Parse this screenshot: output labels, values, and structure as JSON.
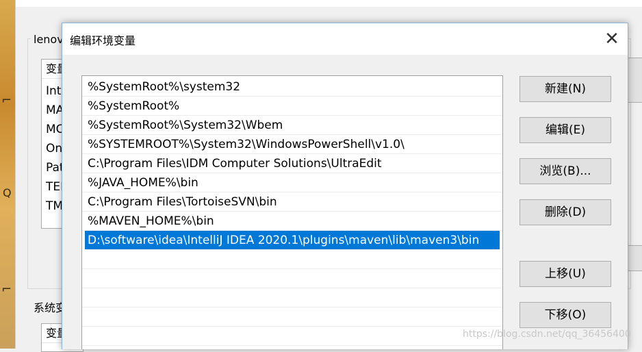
{
  "dialog": {
    "title": "编辑环境变量",
    "close_glyph": "✕",
    "paths": [
      "%SystemRoot%\\system32",
      "%SystemRoot%",
      "%SystemRoot%\\System32\\Wbem",
      "%SYSTEMROOT%\\System32\\WindowsPowerShell\\v1.0\\",
      "C:\\Program Files\\IDM Computer Solutions\\UltraEdit",
      "%JAVA_HOME%\\bin",
      "C:\\Program Files\\TortoiseSVN\\bin",
      "%MAVEN_HOME%\\bin",
      "D:\\software\\idea\\IntelliJ IDEA 2020.1\\plugins\\maven\\lib\\maven3\\bin"
    ],
    "selected_index": 8,
    "buttons": {
      "new": "新建(N)",
      "edit": "编辑(E)",
      "browse": "浏览(B)...",
      "delete": "删除(D)",
      "move_up": "上移(U)",
      "move_down": "下移(O)"
    }
  },
  "parent": {
    "user_group_title": "lenov",
    "user_list_header": "变量",
    "user_rows": [
      "Int",
      "MA",
      "MC",
      "On",
      "Pat",
      "TEI",
      "TM"
    ],
    "system_group_title": "系统变",
    "system_list_header": "变量"
  },
  "watermark": "https://blog.csdn.net/qq_36456400",
  "colors": {
    "selection": "#0078d7",
    "button_bg": "#e1e1e1"
  }
}
